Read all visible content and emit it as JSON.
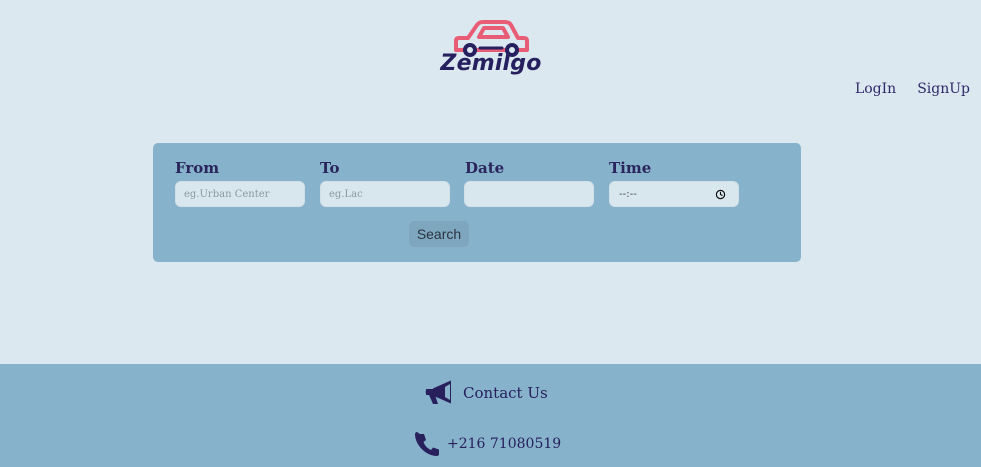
{
  "brand": {
    "logo_icon": "car-icon",
    "name": "Zemilgo",
    "accent_color": "#e85d75",
    "text_color": "#26205f"
  },
  "nav": {
    "login_label": "LogIn",
    "signup_label": "SignUp"
  },
  "search": {
    "from_label": "From",
    "from_placeholder": "eg.Urban Center",
    "to_label": "To",
    "to_placeholder": "eg.Lac",
    "date_label": "Date",
    "date_value": "",
    "time_label": "Time",
    "time_value": "--:--",
    "time_icon": "clock-icon",
    "button_label": "Search"
  },
  "footer": {
    "contact_icon": "megaphone-icon",
    "contact_label": "Contact Us",
    "phone_icon": "phone-icon",
    "phone_number": "+216 71080519"
  },
  "colors": {
    "page_background": "#dce8f0",
    "panel_background": "#86b2cb",
    "input_background": "#d8e6ee"
  }
}
